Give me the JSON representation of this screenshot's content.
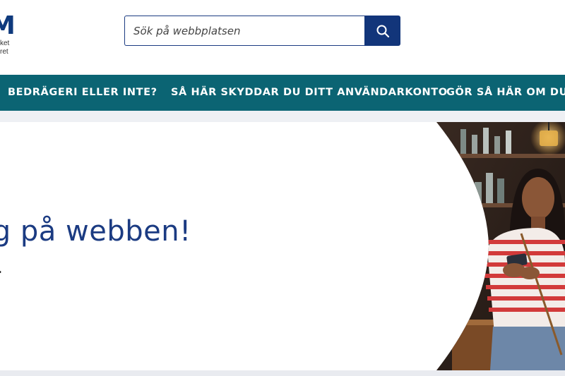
{
  "logo": {
    "mark": "M",
    "line1": "ket",
    "line2": "ret"
  },
  "search": {
    "placeholder": "Sök på webbplatsen",
    "button_icon": "search-icon"
  },
  "nav": {
    "items": [
      {
        "label": "BEDRÄGERI ELLER INTE?"
      },
      {
        "label": "SÅ HÄR SKYDDAR DU DITT ANVÄNDARKONTO"
      },
      {
        "label": "GÖR SÅ HÄR OM DU H"
      }
    ]
  },
  "hero": {
    "heading": "tig på webben!",
    "subheading": "t.",
    "image": "woman-with-smartphone-photo"
  },
  "colors": {
    "brand": "#1b3b82",
    "nav": "#0b6473",
    "button": "#12357a"
  }
}
